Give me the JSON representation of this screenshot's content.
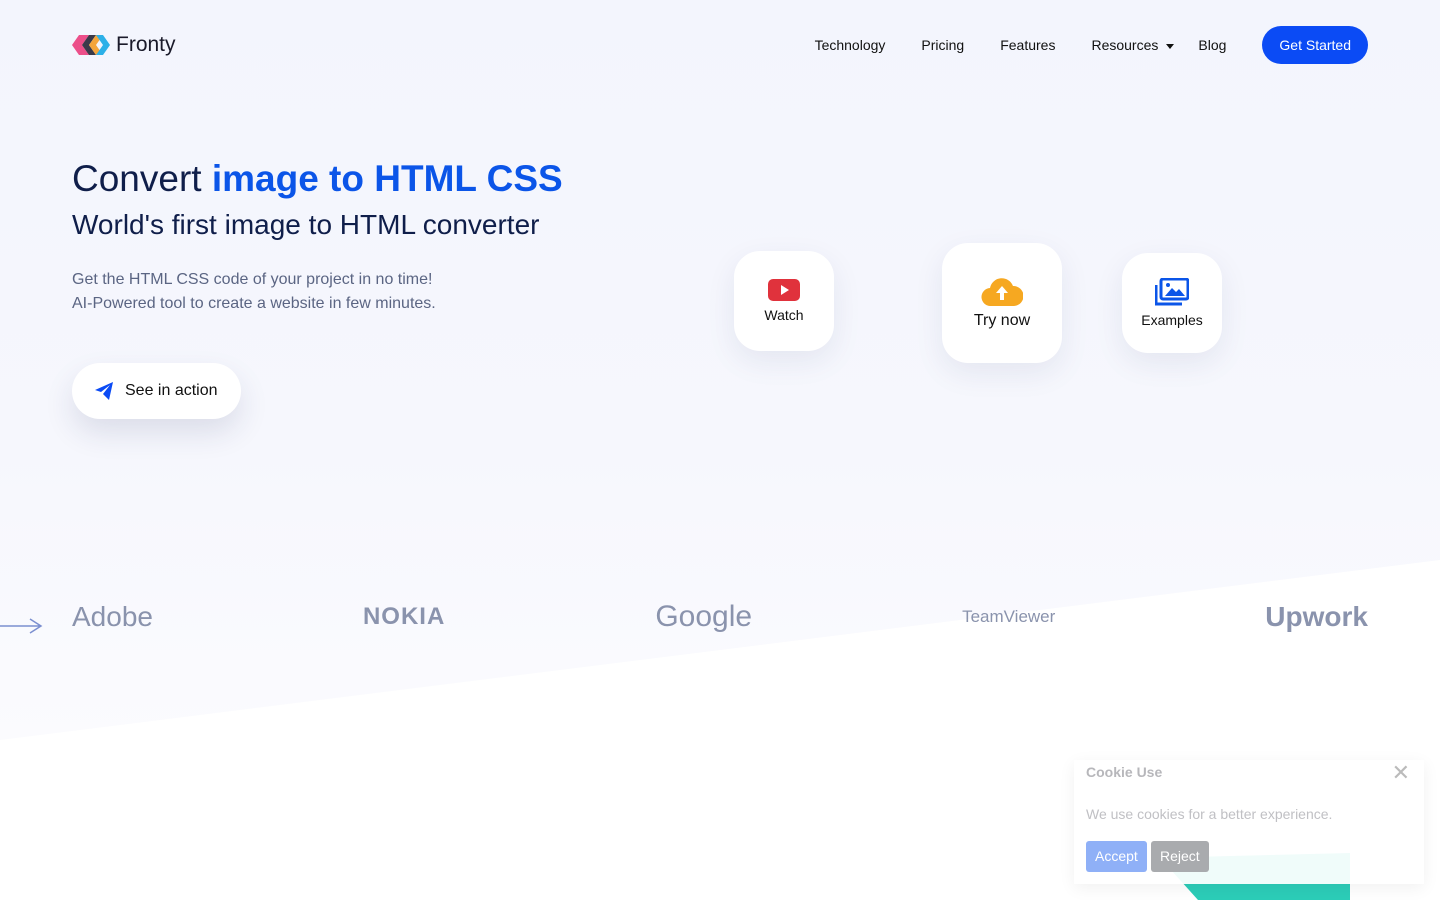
{
  "brand": "Fronty",
  "nav": {
    "items": [
      "Technology",
      "Pricing",
      "Features",
      "Resources",
      "Blog"
    ],
    "cta": "Get Started"
  },
  "hero": {
    "title_plain": "Convert ",
    "title_accent": "image to HTML CSS",
    "subtitle": "World's first image to HTML converter",
    "desc1": "Get the HTML CSS code of your project in no time!",
    "desc2": "AI-Powered tool to create a website in few minutes.",
    "see_action": "See in action"
  },
  "cards": {
    "watch": "Watch",
    "try": "Try now",
    "examples": "Examples"
  },
  "logos": [
    "Adobe",
    "NOKIA",
    "Google",
    "TeamViewer",
    "Upwork"
  ],
  "cookie": {
    "title": "Cookie Use",
    "message": "We use cookies for a better experience.",
    "accept": "Accept",
    "reject": "Reject"
  },
  "colors": {
    "accent": "#0b4bf5",
    "youtube": "#e0323c",
    "cloud": "#f6a821"
  }
}
